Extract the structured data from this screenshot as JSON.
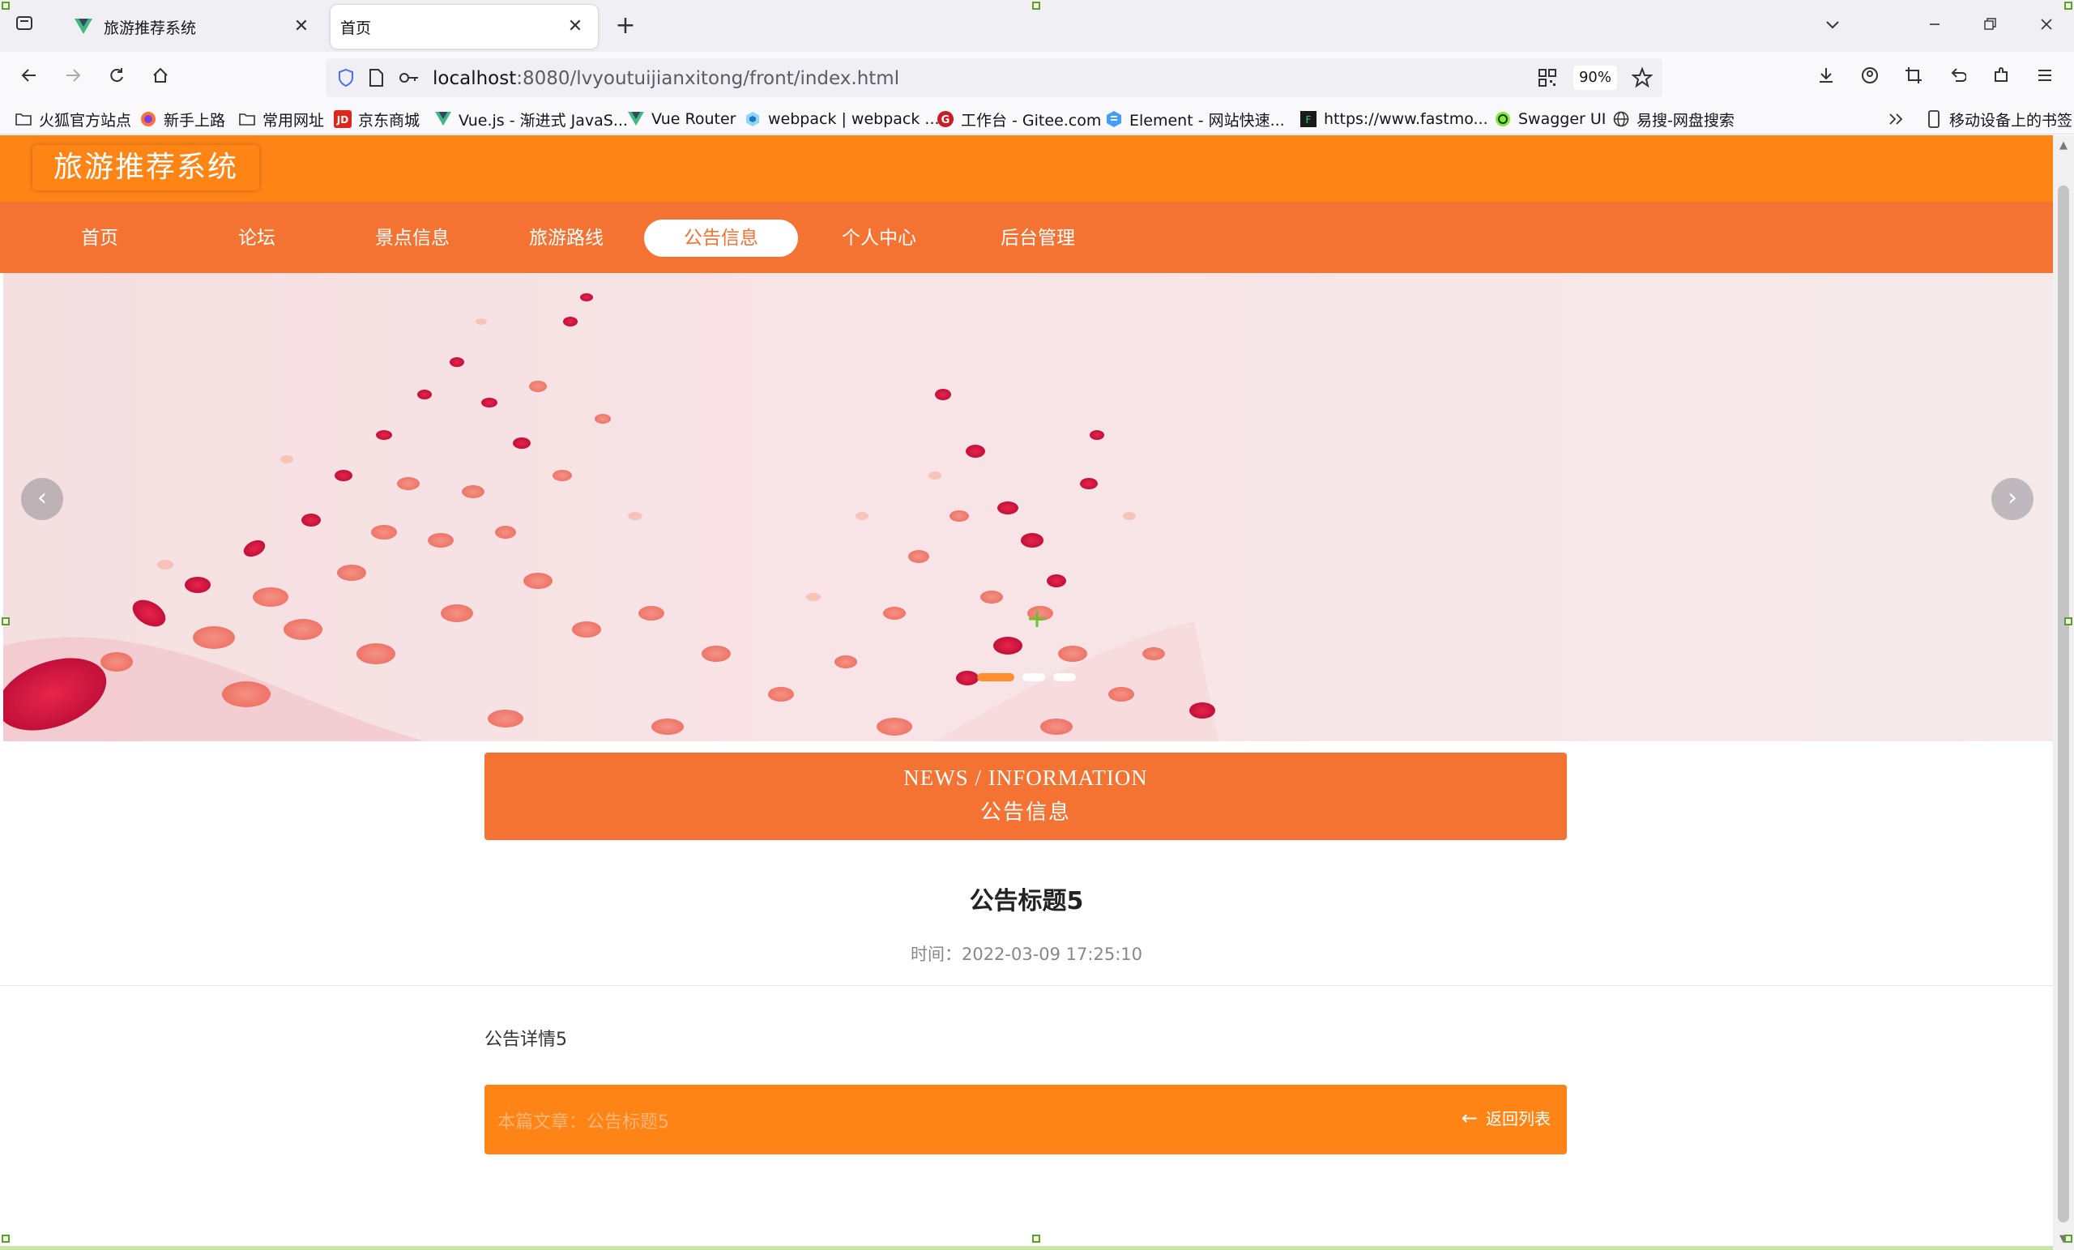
{
  "browser": {
    "tabs": [
      {
        "title": "旅游推荐系统",
        "active": false
      },
      {
        "title": "首页",
        "active": true
      }
    ],
    "new_tab_label": "+",
    "url_host": "localhost",
    "url_path": ":8080/lvyoutuijianxitong/front/index.html",
    "zoom": "90%",
    "bookmarks": [
      {
        "label": "火狐官方站点",
        "icon": "folder-icon"
      },
      {
        "label": "新手上路",
        "icon": "firefox-icon"
      },
      {
        "label": "常用网址",
        "icon": "folder-icon"
      },
      {
        "label": "京东商城",
        "icon": "jd-icon"
      },
      {
        "label": "Vue.js - 渐进式 JavaS...",
        "icon": "vue-icon"
      },
      {
        "label": "Vue Router",
        "icon": "vue-icon"
      },
      {
        "label": "webpack | webpack ...",
        "icon": "webpack-icon"
      },
      {
        "label": "工作台 - Gitee.com",
        "icon": "gitee-icon"
      },
      {
        "label": "Element - 网站快速...",
        "icon": "element-icon"
      },
      {
        "label": "https://www.fastmo...",
        "icon": "fastmock-icon"
      },
      {
        "label": "Swagger UI",
        "icon": "swagger-icon"
      },
      {
        "label": "易搜-网盘搜索",
        "icon": "globe-icon"
      }
    ],
    "mobile_bookmarks": "移动设备上的书签"
  },
  "site": {
    "logo": "旅游推荐系统",
    "menu": [
      {
        "label": "首页",
        "active": false
      },
      {
        "label": "论坛",
        "active": false
      },
      {
        "label": "景点信息",
        "active": false
      },
      {
        "label": "旅游路线",
        "active": false
      },
      {
        "label": "公告信息",
        "active": true
      },
      {
        "label": "个人中心",
        "active": false
      },
      {
        "label": "后台管理",
        "active": false
      }
    ],
    "carousel": {
      "slide_count": 3,
      "active_index": 0
    }
  },
  "section": {
    "title_en": "NEWS / INFORMATION",
    "title_zh": "公告信息"
  },
  "article": {
    "title": "公告标题5",
    "time": "时间：2022-03-09 17:25:10",
    "content": "公告详情5"
  },
  "pager": {
    "prev_text": "本篇文章：公告标题5",
    "back_label": "返回列表"
  },
  "colors": {
    "header": "#ff8416",
    "menu": "#f47232",
    "section": "#f47232",
    "pager": "#ff8416"
  }
}
